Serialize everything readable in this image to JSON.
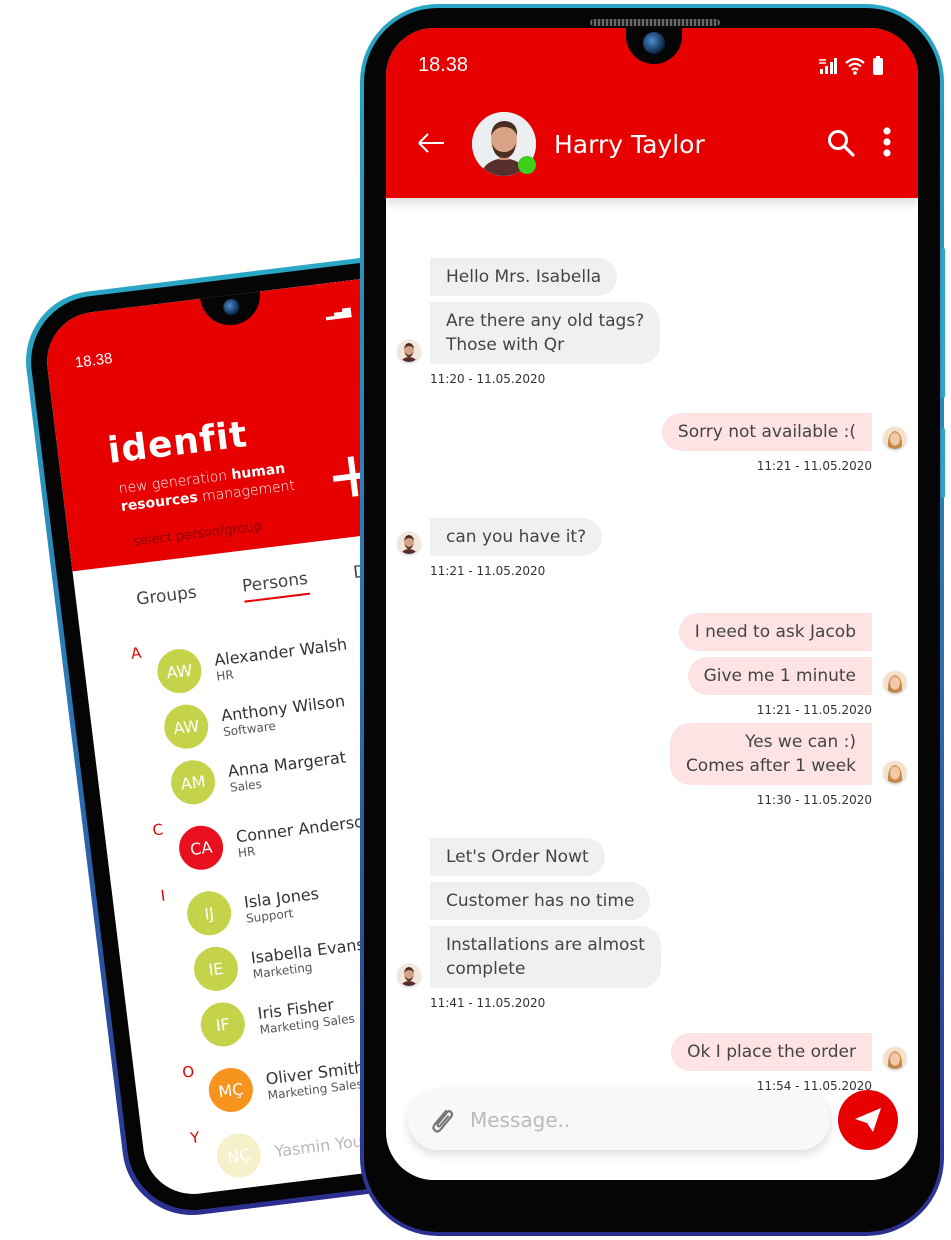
{
  "colors": {
    "brand_red": "#e60000",
    "incoming_bubble": "#f0f0f0",
    "outgoing_bubble": "#fde3e3",
    "online": "#3ed11b",
    "avatar_green": "#c5d34a",
    "avatar_red": "#e8101e",
    "avatar_orange": "#f7941d"
  },
  "back_phone": {
    "status_time": "18.38",
    "brand": "idenfit",
    "tagline_line1_light": "new generation ",
    "tagline_line1_bold": "human",
    "tagline_line2_bold": "resources",
    "tagline_line2_light": " management",
    "select_hint": "select person/group",
    "tabs": [
      {
        "label": "Groups",
        "active": false
      },
      {
        "label": "Persons",
        "active": true
      },
      {
        "label": "Depa",
        "active": false
      }
    ],
    "sections": [
      {
        "letter": "A",
        "contacts": [
          {
            "initials": "AW",
            "name": "Alexander Walsh",
            "dept": "HR",
            "color": "#c5d34a"
          },
          {
            "initials": "AW",
            "name": "Anthony Wilson",
            "dept": "Software",
            "color": "#c5d34a"
          },
          {
            "initials": "AM",
            "name": "Anna Margerat",
            "dept": "Sales",
            "color": "#c5d34a"
          }
        ]
      },
      {
        "letter": "C",
        "contacts": [
          {
            "initials": "CA",
            "name": "Conner Anderson",
            "dept": "HR",
            "color": "#e8101e"
          }
        ]
      },
      {
        "letter": "I",
        "contacts": [
          {
            "initials": "IJ",
            "name": "Isla Jones",
            "dept": "Support",
            "color": "#c5d34a"
          },
          {
            "initials": "IE",
            "name": "Isabella Evans",
            "dept": "Marketing",
            "color": "#c5d34a"
          },
          {
            "initials": "IF",
            "name": "Iris Fisher",
            "dept": "Marketing Sales",
            "color": "#c5d34a"
          }
        ]
      },
      {
        "letter": "O",
        "contacts": [
          {
            "initials": "MÇ",
            "name": "Oliver Smith",
            "dept": "Marketing Sales",
            "color": "#f7941d"
          }
        ]
      },
      {
        "letter": "Y",
        "contacts": [
          {
            "initials": "NÇ",
            "name": "Yasmin Younger",
            "dept": "",
            "color": "#e6d36a"
          }
        ]
      }
    ]
  },
  "front_phone": {
    "status_time": "18.38",
    "header": {
      "contact_name": "Harry Taylor",
      "online": true
    },
    "messages": [
      {
        "side": "in",
        "bubbles": [
          "Hello Mrs. Isabella",
          "Are there any old tags?\nThose with Qr"
        ],
        "timestamp": "11:20 - 11.05.2020"
      },
      {
        "side": "out",
        "bubbles": [
          "Sorry not available :("
        ],
        "timestamp": "11:21 - 11.05.2020"
      },
      {
        "side": "in",
        "bubbles": [
          "can you have it?"
        ],
        "timestamp": "11:21 - 11.05.2020"
      },
      {
        "side": "out",
        "bubbles": [
          "I need to ask Jacob",
          "Give me 1 minute"
        ],
        "timestamp": "11:21 - 11.05.2020"
      },
      {
        "side": "out",
        "bubbles": [
          "Yes we can :)\nComes after 1 week"
        ],
        "timestamp": "11:30 - 11.05.2020"
      },
      {
        "side": "in",
        "bubbles": [
          "Let's Order Nowt",
          "Customer has no time",
          "Installations are almost\ncomplete"
        ],
        "timestamp": "11:41 - 11.05.2020"
      },
      {
        "side": "out",
        "bubbles": [
          "Ok  I place the order"
        ],
        "timestamp": "11:54 - 11.05.2020"
      }
    ],
    "composer": {
      "placeholder": "Message..",
      "value": ""
    }
  }
}
